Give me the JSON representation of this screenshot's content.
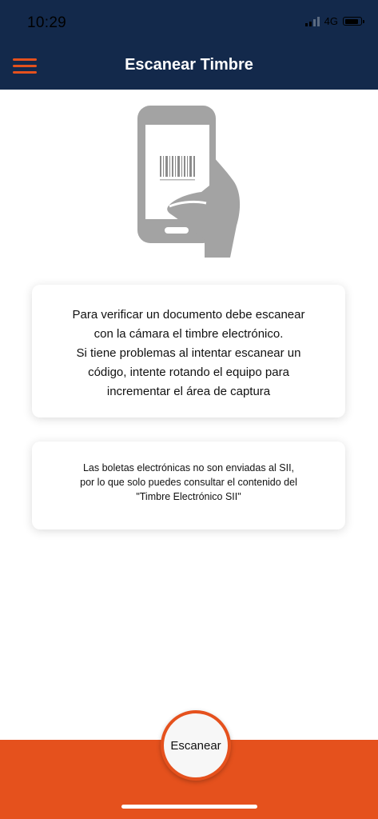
{
  "status_bar": {
    "time": "10:29",
    "network": "4G"
  },
  "header": {
    "title": "Escanear Timbre",
    "menu_icon": "hamburger-menu-icon"
  },
  "illustration": {
    "icon": "phone-barcode-scan-icon"
  },
  "instructions": {
    "lines": [
      "Para verificar un documento debe escanear",
      "con la cámara el timbre electrónico.",
      "Si tiene problemas al intentar escanear un",
      "código, intente rotando el equipo para",
      "incrementar el área de captura"
    ]
  },
  "note": {
    "lines": [
      "Las boletas electrónicas no son enviadas al SII,",
      "por lo que solo puedes consultar el contenido del",
      "\"Timbre Electrónico SII\""
    ]
  },
  "actions": {
    "scan_label": "Escanear"
  },
  "colors": {
    "header_bg": "#13294b",
    "accent": "#e5511d",
    "illustration_gray": "#a3a3a3"
  }
}
